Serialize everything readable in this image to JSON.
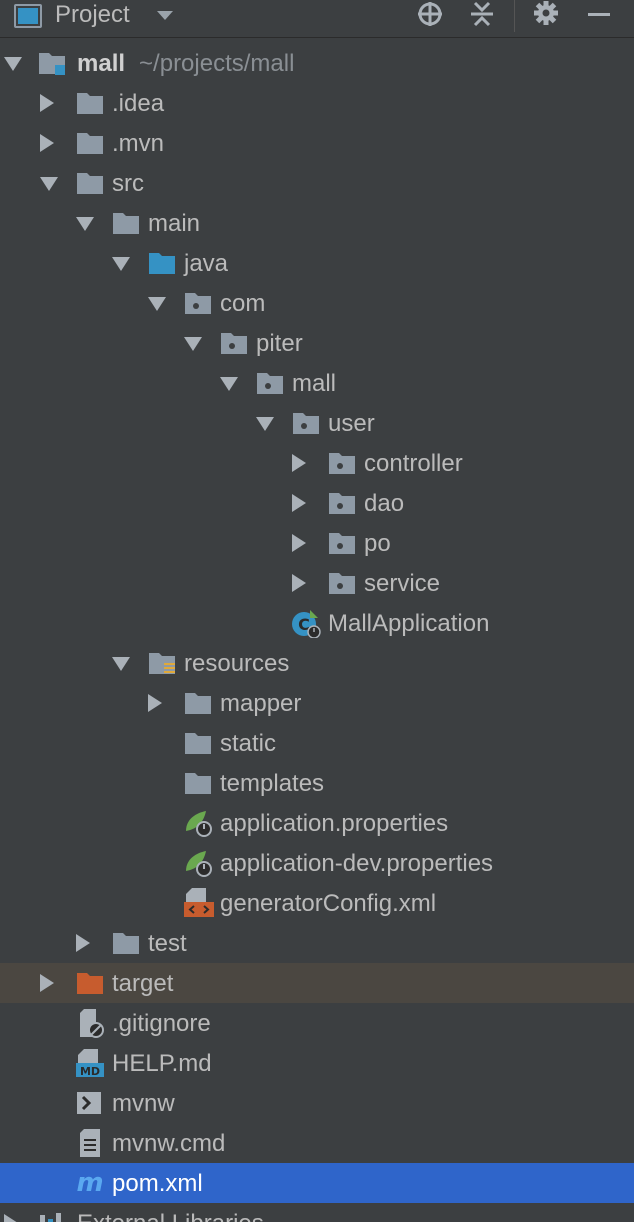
{
  "toolbar": {
    "title": "Project",
    "icons": [
      "project-view-icon",
      "dropdown-icon",
      "locate-icon",
      "collapse-all-icon",
      "gear-icon",
      "minimize-icon"
    ]
  },
  "colors": {
    "background": "#3c3f41",
    "selection": "#2f65ca",
    "excluded_row": "#4b4741",
    "folder": "#8e9aa6",
    "source_folder": "#3592c4",
    "excluded_folder": "#c75c2e",
    "spring_green": "#6aa84f"
  },
  "tree": {
    "items": [
      {
        "label": "mall",
        "path_hint": "~/projects/mall",
        "icon": "module-folder-icon",
        "state": "expanded"
      },
      {
        "label": ".idea",
        "icon": "folder-icon",
        "state": "collapsed"
      },
      {
        "label": ".mvn",
        "icon": "folder-icon",
        "state": "collapsed"
      },
      {
        "label": "src",
        "icon": "folder-icon",
        "state": "expanded"
      },
      {
        "label": "main",
        "icon": "folder-icon",
        "state": "expanded"
      },
      {
        "label": "java",
        "icon": "source-folder-icon",
        "state": "expanded"
      },
      {
        "label": "com",
        "icon": "package-icon",
        "state": "expanded"
      },
      {
        "label": "piter",
        "icon": "package-icon",
        "state": "expanded"
      },
      {
        "label": "mall",
        "icon": "package-icon",
        "state": "expanded"
      },
      {
        "label": "user",
        "icon": "package-icon",
        "state": "expanded"
      },
      {
        "label": "controller",
        "icon": "package-icon",
        "state": "collapsed"
      },
      {
        "label": "dao",
        "icon": "package-icon",
        "state": "collapsed"
      },
      {
        "label": "po",
        "icon": "package-icon",
        "state": "collapsed"
      },
      {
        "label": "service",
        "icon": "package-icon",
        "state": "collapsed"
      },
      {
        "label": "MallApplication",
        "icon": "spring-boot-class-icon",
        "state": "leaf"
      },
      {
        "label": "resources",
        "icon": "resources-folder-icon",
        "state": "expanded"
      },
      {
        "label": "mapper",
        "icon": "folder-icon",
        "state": "collapsed"
      },
      {
        "label": "static",
        "icon": "folder-icon",
        "state": "leaf"
      },
      {
        "label": "templates",
        "icon": "folder-icon",
        "state": "leaf"
      },
      {
        "label": "application.properties",
        "icon": "spring-properties-icon",
        "state": "leaf"
      },
      {
        "label": "application-dev.properties",
        "icon": "spring-properties-icon",
        "state": "leaf"
      },
      {
        "label": "generatorConfig.xml",
        "icon": "xml-file-icon",
        "state": "leaf"
      },
      {
        "label": "test",
        "icon": "folder-icon",
        "state": "collapsed"
      },
      {
        "label": "target",
        "icon": "excluded-folder-icon",
        "state": "collapsed"
      },
      {
        "label": ".gitignore",
        "icon": "ignore-file-icon",
        "state": "leaf"
      },
      {
        "label": "HELP.md",
        "icon": "markdown-file-icon",
        "state": "leaf"
      },
      {
        "label": "mvnw",
        "icon": "shell-script-icon",
        "state": "leaf"
      },
      {
        "label": "mvnw.cmd",
        "icon": "text-file-icon",
        "state": "leaf"
      },
      {
        "label": "pom.xml",
        "icon": "maven-icon",
        "state": "leaf",
        "selected": true
      },
      {
        "label": "External Libraries",
        "icon": "libraries-icon",
        "state": "collapsed"
      }
    ]
  }
}
